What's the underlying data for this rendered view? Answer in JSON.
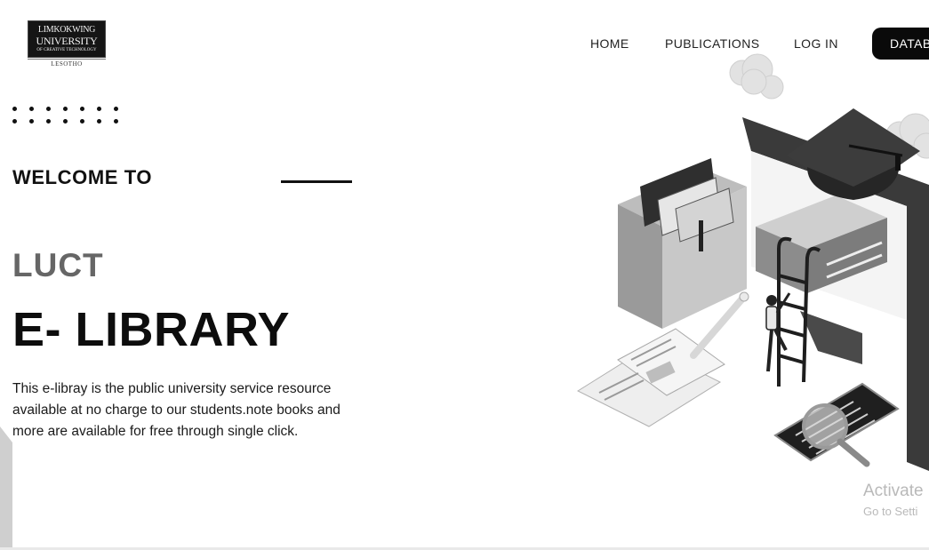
{
  "logo": {
    "line1": "LIMKOKWING",
    "line2": "UNIVERSITY",
    "line3": "OF CREATIVE TECHNOLOGY",
    "subtitle": "LESOTHO"
  },
  "nav": {
    "items": [
      "HOME",
      "PUBLICATIONS",
      "LOG IN"
    ],
    "cta_label": "DATABASE"
  },
  "hero": {
    "welcome": "WELCOME TO",
    "org": "LUCT",
    "title": "E- LIBRARY",
    "description": "This e-libray is the public university service resource available at no charge to our students.note books and more are available for free through single click."
  },
  "illustration": {
    "icon": "library-books-graduation-illustration"
  },
  "watermark": {
    "line1": "Activate",
    "line2": "Go to Setti"
  },
  "colors": {
    "primary": "#0a0a0a",
    "muted_heading": "#666666",
    "background": "#ffffff"
  }
}
